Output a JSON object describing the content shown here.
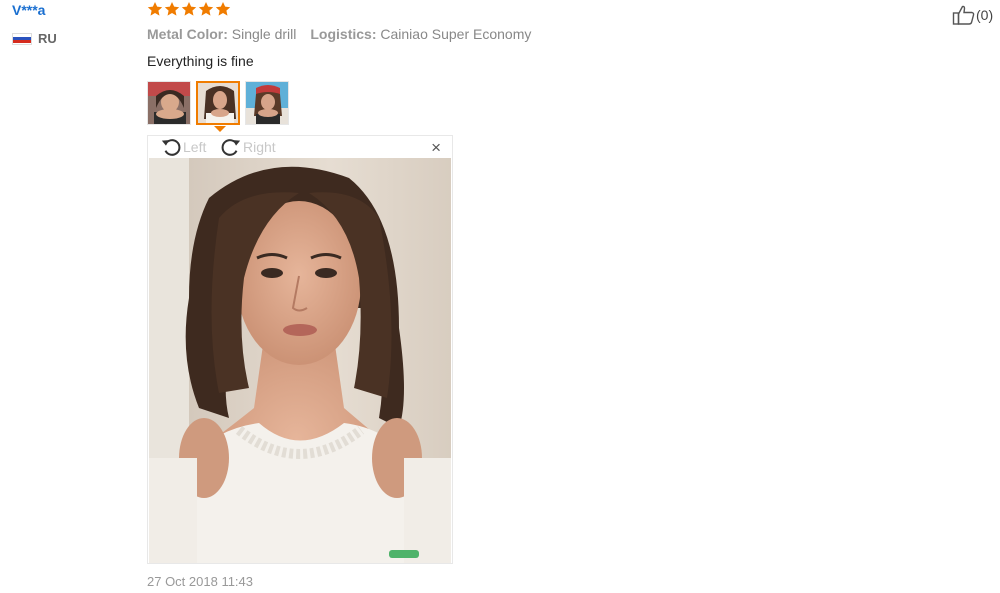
{
  "review": {
    "username": "V***a",
    "country": "RU",
    "rating": 5,
    "rating_max": 5,
    "attributes": [
      {
        "label": "Metal Color:",
        "value": "Single drill"
      },
      {
        "label": "Logistics:",
        "value": "Cainiao Super Economy"
      }
    ],
    "feedback": "Everything is fine",
    "date": "27 Oct 2018 11:43",
    "likes": "(0)"
  },
  "viewer": {
    "rotate_left": "Left",
    "rotate_right": "Right",
    "close": "×",
    "selected_thumbnail": 2
  },
  "colors": {
    "username": "#1a6fd0",
    "star": "#f07c00",
    "active_thumb_border": "#f07c00"
  },
  "icons": {
    "flag": "russia-flag-icon",
    "star": "star-icon",
    "like": "thumbs-up-icon",
    "rotate_left": "rotate-left-icon",
    "rotate_right": "rotate-right-icon",
    "close": "close-icon"
  }
}
